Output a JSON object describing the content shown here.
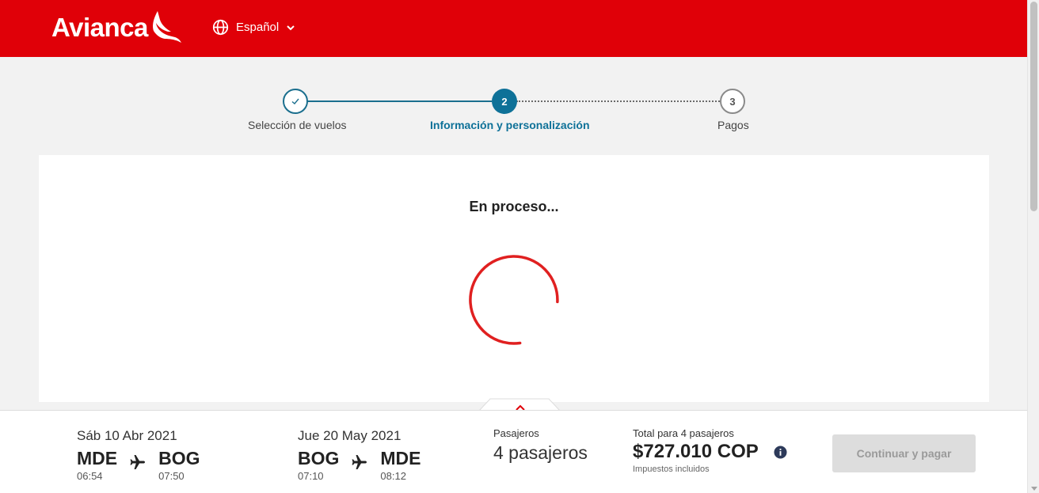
{
  "header": {
    "brand": "Avianca",
    "language": "Español",
    "bg_color": "#e00008"
  },
  "stepper": {
    "steps": [
      {
        "number": "✓",
        "label": "Selección de vuelos",
        "state": "completed"
      },
      {
        "number": "2",
        "label": "Información y personalización",
        "state": "active"
      },
      {
        "number": "3",
        "label": "Pagos",
        "state": "pending"
      }
    ],
    "active_color": "#0e7198"
  },
  "main": {
    "status_text": "En proceso...",
    "spinner_color": "#e02020"
  },
  "summary": {
    "outbound": {
      "date": "Sáb 10 Abr 2021",
      "from_code": "MDE",
      "from_time": "06:54",
      "to_code": "BOG",
      "to_time": "07:50"
    },
    "inbound": {
      "date": "Jue 20 May 2021",
      "from_code": "BOG",
      "from_time": "07:10",
      "to_code": "MDE",
      "to_time": "08:12"
    },
    "passengers_label": "Pasajeros",
    "passengers_value": "4 pasajeros",
    "total_label": "Total para 4 pasajeros",
    "total_amount": "$727.010 COP",
    "total_note": "Impuestos incluidos",
    "cta_label": "Continuar y pagar"
  }
}
